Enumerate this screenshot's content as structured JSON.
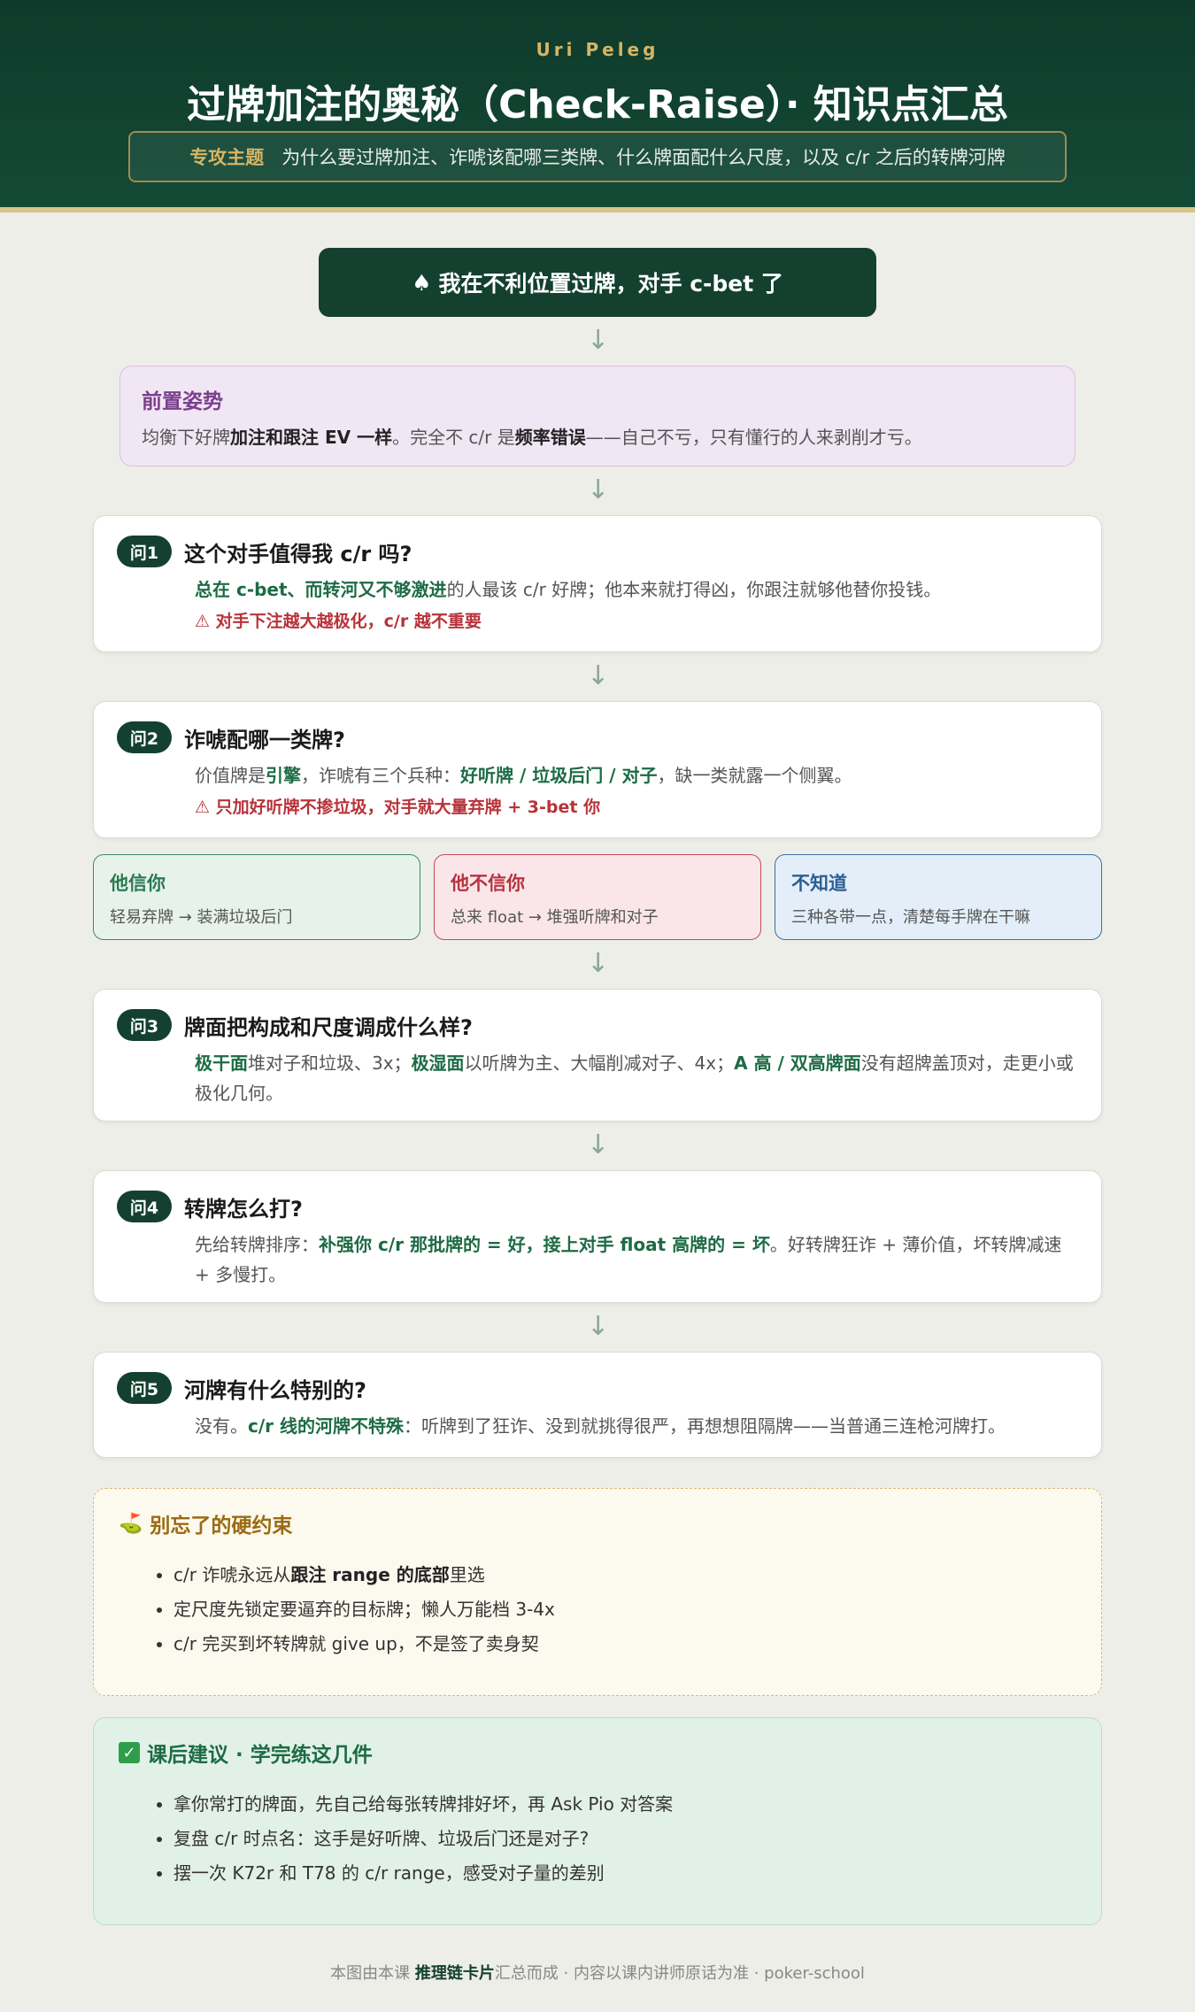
{
  "header": {
    "author": "Uri Peleg",
    "title": "过牌加注的奥秘（Check-Raise）· 知识点汇总",
    "topic_label": "专攻主题",
    "topic_text": "为什么要过牌加注、诈唬该配哪三类牌、什么牌面配什么尺度，以及 c/r 之后的转牌河牌"
  },
  "start": {
    "icon": "spade-icon",
    "text": "我在不利位置过牌，对手 c-bet 了"
  },
  "premise": {
    "title": "前置姿势",
    "t1": "均衡下好牌",
    "b1": "加注和跟注 EV 一样",
    "t2": "。完全不 c/r 是",
    "b2": "频率错误",
    "t3": "——自己不亏，只有懂行的人来剥削才亏。"
  },
  "questions": [
    {
      "badge": "问1",
      "title": "这个对手值得我 c/r 吗?",
      "b1": "总在 c-bet、而转河又不够激进",
      "t1": "的人最该 c/r 好牌；他本来就打得凶，你跟注就够他替你投钱。",
      "warn": "⚠ 对手下注越大越极化，c/r 越不重要"
    },
    {
      "badge": "问2",
      "title": "诈唬配哪一类牌?",
      "t1": "价值牌是",
      "b1": "引擎",
      "t2": "，诈唬有三个兵种：",
      "b2": "好听牌 / 垃圾后门 / 对子",
      "t3": "，缺一类就露一个侧翼。",
      "warn": "⚠ 只加好听牌不掺垃圾，对手就大量弃牌 + 3-bet 你"
    },
    {
      "badge": "问3",
      "title": "牌面把构成和尺度调成什么样?",
      "b1": "极干面",
      "t1": "堆对子和垃圾、3x；",
      "b2": "极湿面",
      "t2": "以听牌为主、大幅削减对子、4x；",
      "b3": "A 高 / 双高牌面",
      "t3": "没有超牌盖顶对，走更小或极化几何。"
    },
    {
      "badge": "问4",
      "title": "转牌怎么打?",
      "t1": "先给转牌排序：",
      "b1": "补强你 c/r 那批牌的 = 好，接上对手 float 高牌的 = 坏",
      "t2": "。好转牌狂诈 + 薄价值，坏转牌减速 + 多慢打。"
    },
    {
      "badge": "问5",
      "title": "河牌有什么特别的?",
      "t1": "没有。",
      "b1": "c/r 线的河牌不特殊",
      "t2": "：听牌到了狂诈、没到就挑得很严，再想想阻隔牌——当普通三连枪河牌打。"
    }
  ],
  "reads": [
    {
      "title": "他信你",
      "text": "轻易弃牌 → 装满垃圾后门"
    },
    {
      "title": "他不信你",
      "text": "总来 float → 堆强听牌和对子"
    },
    {
      "title": "不知道",
      "text": "三种各带一点，清楚每手牌在干嘛"
    }
  ],
  "reminder": {
    "icon": "flag-icon",
    "title": "别忘了的硬约束",
    "i1_t1": "c/r 诈唬永远从",
    "i1_b1": "跟注 range 的底部",
    "i1_t2": "里选",
    "i2": "定尺度先锁定要逼弃的目标牌；懒人万能档 3-4x",
    "i3": "c/r 完买到坏转牌就 give up，不是签了卖身契"
  },
  "homework": {
    "icon": "check-icon",
    "title": "课后建议 · 学完练这几件",
    "items": [
      "拿你常打的牌面，先自己给每张转牌排好坏，再 Ask Pio 对答案",
      "复盘 c/r 时点名：这手是好听牌、垃圾后门还是对子?",
      "摆一次 K72r 和 T78 的 c/r range，感受对子量的差别"
    ]
  },
  "footer": {
    "t1": "本图由本课 ",
    "b1": "推理链卡片",
    "t2": "汇总而成 · 内容以课内讲师原话为准 · poker-school"
  }
}
